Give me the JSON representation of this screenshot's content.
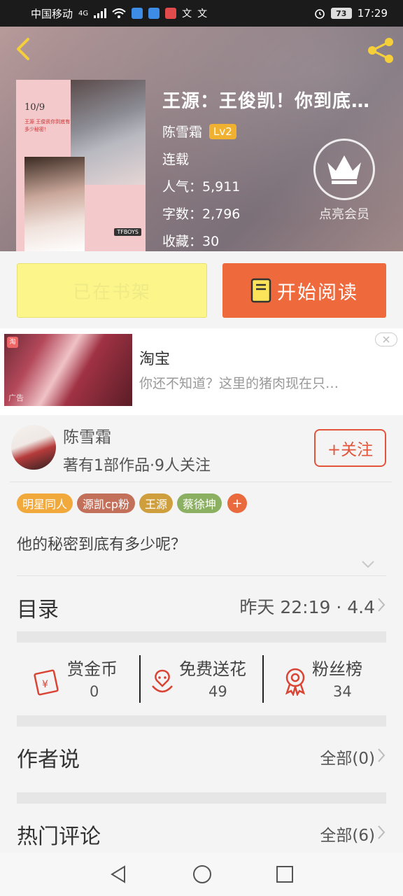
{
  "status_bar": {
    "carrier": "中国移动",
    "network": "4G",
    "time": "17:29",
    "battery": "73"
  },
  "book": {
    "title": "王源：王俊凯！你到底…",
    "author": "陈雪霜",
    "level": "Lv2",
    "status": "连载",
    "popularity": "人气：5,911",
    "word_count": "字数：2,796",
    "favorites": "收藏：30",
    "cover": {
      "date": "10/9",
      "lines": "王源 王俊凯你到底有多少秘密！",
      "tag": "TFBOYS"
    }
  },
  "vip": {
    "label": "点亮会员"
  },
  "actions": {
    "shelf_label": "已在书架",
    "read_label": "开始阅读"
  },
  "ad": {
    "title": "淘宝",
    "desc": "你还不知道？这里的猪肉现在只…",
    "mark": "广告"
  },
  "author_card": {
    "name": "陈雪霜",
    "meta": "著有1部作品·9人关注",
    "follow_label": "+关注"
  },
  "tags": [
    {
      "label": "明星同人",
      "color": "#f2a93b"
    },
    {
      "label": "源凯cp粉",
      "color": "#c3705a"
    },
    {
      "label": "王源",
      "color": "#cf9f3e"
    },
    {
      "label": "蔡徐坤",
      "color": "#8cb062"
    }
  ],
  "tag_add": "+",
  "intro": "他的秘密到底有多少呢？",
  "toc": {
    "label": "目录",
    "meta": "昨天 22:19 · 4.4"
  },
  "stats": [
    {
      "label": "赏金币",
      "value": "0",
      "icon": "coin-envelope-icon"
    },
    {
      "label": "免费送花",
      "value": "49",
      "icon": "flower-icon"
    },
    {
      "label": "粉丝榜",
      "value": "34",
      "icon": "award-medal-icon"
    }
  ],
  "author_says": {
    "label": "作者说",
    "count": "全部(0)"
  },
  "hot_comments": {
    "label": "热门评论",
    "count": "全部(6)"
  },
  "colors": {
    "accent": "#ee6a3d",
    "follow": "#e2553b",
    "shelf_bg": "#fbf58a"
  }
}
